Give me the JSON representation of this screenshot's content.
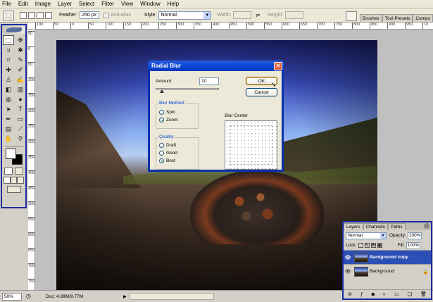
{
  "menu": [
    "File",
    "Edit",
    "Image",
    "Layer",
    "Select",
    "Filter",
    "View",
    "Window",
    "Help"
  ],
  "options_bar": {
    "feather_label": "Feather:",
    "feather_value": "250 px",
    "antialias_label": "Anti-alias",
    "style_label": "Style:",
    "style_value": "Normal",
    "width_label": "Width:",
    "height_label": "Height:",
    "swap_icon": "⇄"
  },
  "palette_well_tabs": [
    "Brushes",
    "Tool Presets",
    "Comps"
  ],
  "ruler_top": [
    "100",
    "50",
    "0",
    "50",
    "100",
    "150",
    "200",
    "250",
    "300",
    "350",
    "400",
    "450",
    "500",
    "550",
    "600",
    "650",
    "700",
    "750",
    "800",
    "850",
    "900",
    "950",
    "10"
  ],
  "ruler_left": [
    "50",
    "0",
    "50",
    "100",
    "150",
    "200",
    "250",
    "300",
    "350",
    "400",
    "450",
    "500",
    "550",
    "600",
    "650",
    "700",
    "750"
  ],
  "tools": [
    {
      "name": "marquee-tool-icon",
      "glyph": "⬚",
      "active": true
    },
    {
      "name": "move-tool-icon",
      "glyph": "✥"
    },
    {
      "name": "lasso-tool-icon",
      "glyph": "ↄ"
    },
    {
      "name": "magic-wand-tool-icon",
      "glyph": "✱"
    },
    {
      "name": "crop-tool-icon",
      "glyph": "⌗"
    },
    {
      "name": "slice-tool-icon",
      "glyph": "✎"
    },
    {
      "name": "healing-brush-tool-icon",
      "glyph": "✚"
    },
    {
      "name": "brush-tool-icon",
      "glyph": "✐"
    },
    {
      "name": "clone-stamp-tool-icon",
      "glyph": "♙"
    },
    {
      "name": "history-brush-tool-icon",
      "glyph": "✍"
    },
    {
      "name": "eraser-tool-icon",
      "glyph": "◧"
    },
    {
      "name": "gradient-tool-icon",
      "glyph": "▥"
    },
    {
      "name": "blur-tool-icon",
      "glyph": "◍"
    },
    {
      "name": "dodge-tool-icon",
      "glyph": "●"
    },
    {
      "name": "path-selection-tool-icon",
      "glyph": "➤"
    },
    {
      "name": "type-tool-icon",
      "glyph": "T"
    },
    {
      "name": "pen-tool-icon",
      "glyph": "✒"
    },
    {
      "name": "shape-tool-icon",
      "glyph": "▭"
    },
    {
      "name": "notes-tool-icon",
      "glyph": "▤"
    },
    {
      "name": "eyedropper-tool-icon",
      "glyph": "⟋"
    },
    {
      "name": "hand-tool-icon",
      "glyph": "✋"
    },
    {
      "name": "zoom-tool-icon",
      "glyph": "⚲"
    }
  ],
  "dialog": {
    "title": "Radial Blur",
    "close_glyph": "✕",
    "amount_label": "Amount",
    "amount_value": "10",
    "amount_fraction": 0.1,
    "ok_label": "OK",
    "cancel_label": "Cancel",
    "blur_method_label": "Blur Method:",
    "blur_methods": [
      {
        "label": "Spin",
        "selected": false
      },
      {
        "label": "Zoom",
        "selected": true
      }
    ],
    "quality_label": "Quality:",
    "qualities": [
      {
        "label": "Draft",
        "selected": false
      },
      {
        "label": "Good",
        "selected": false
      },
      {
        "label": "Best",
        "selected": true
      }
    ],
    "blur_center_label": "Blur Center"
  },
  "statusbar": {
    "zoom": "50%",
    "doc": "Doc: 4.89M/9.77M",
    "arrow": "▶"
  },
  "layers_panel": {
    "tabs": [
      "Layers",
      "Channels",
      "Paths"
    ],
    "blend_mode": "Normal",
    "opacity_label": "Opacity:",
    "opacity_value": "100%",
    "lock_label": "Lock:",
    "fill_label": "Fill:",
    "fill_value": "100%",
    "layers": [
      {
        "name": "Background copy",
        "selected": true,
        "locked": false
      },
      {
        "name": "Background",
        "selected": false,
        "locked": true
      }
    ]
  },
  "colors": {
    "titlebar": "#0a48d8",
    "panel_border": "#1c2ba0",
    "selected_layer": "#2c4fb6"
  }
}
